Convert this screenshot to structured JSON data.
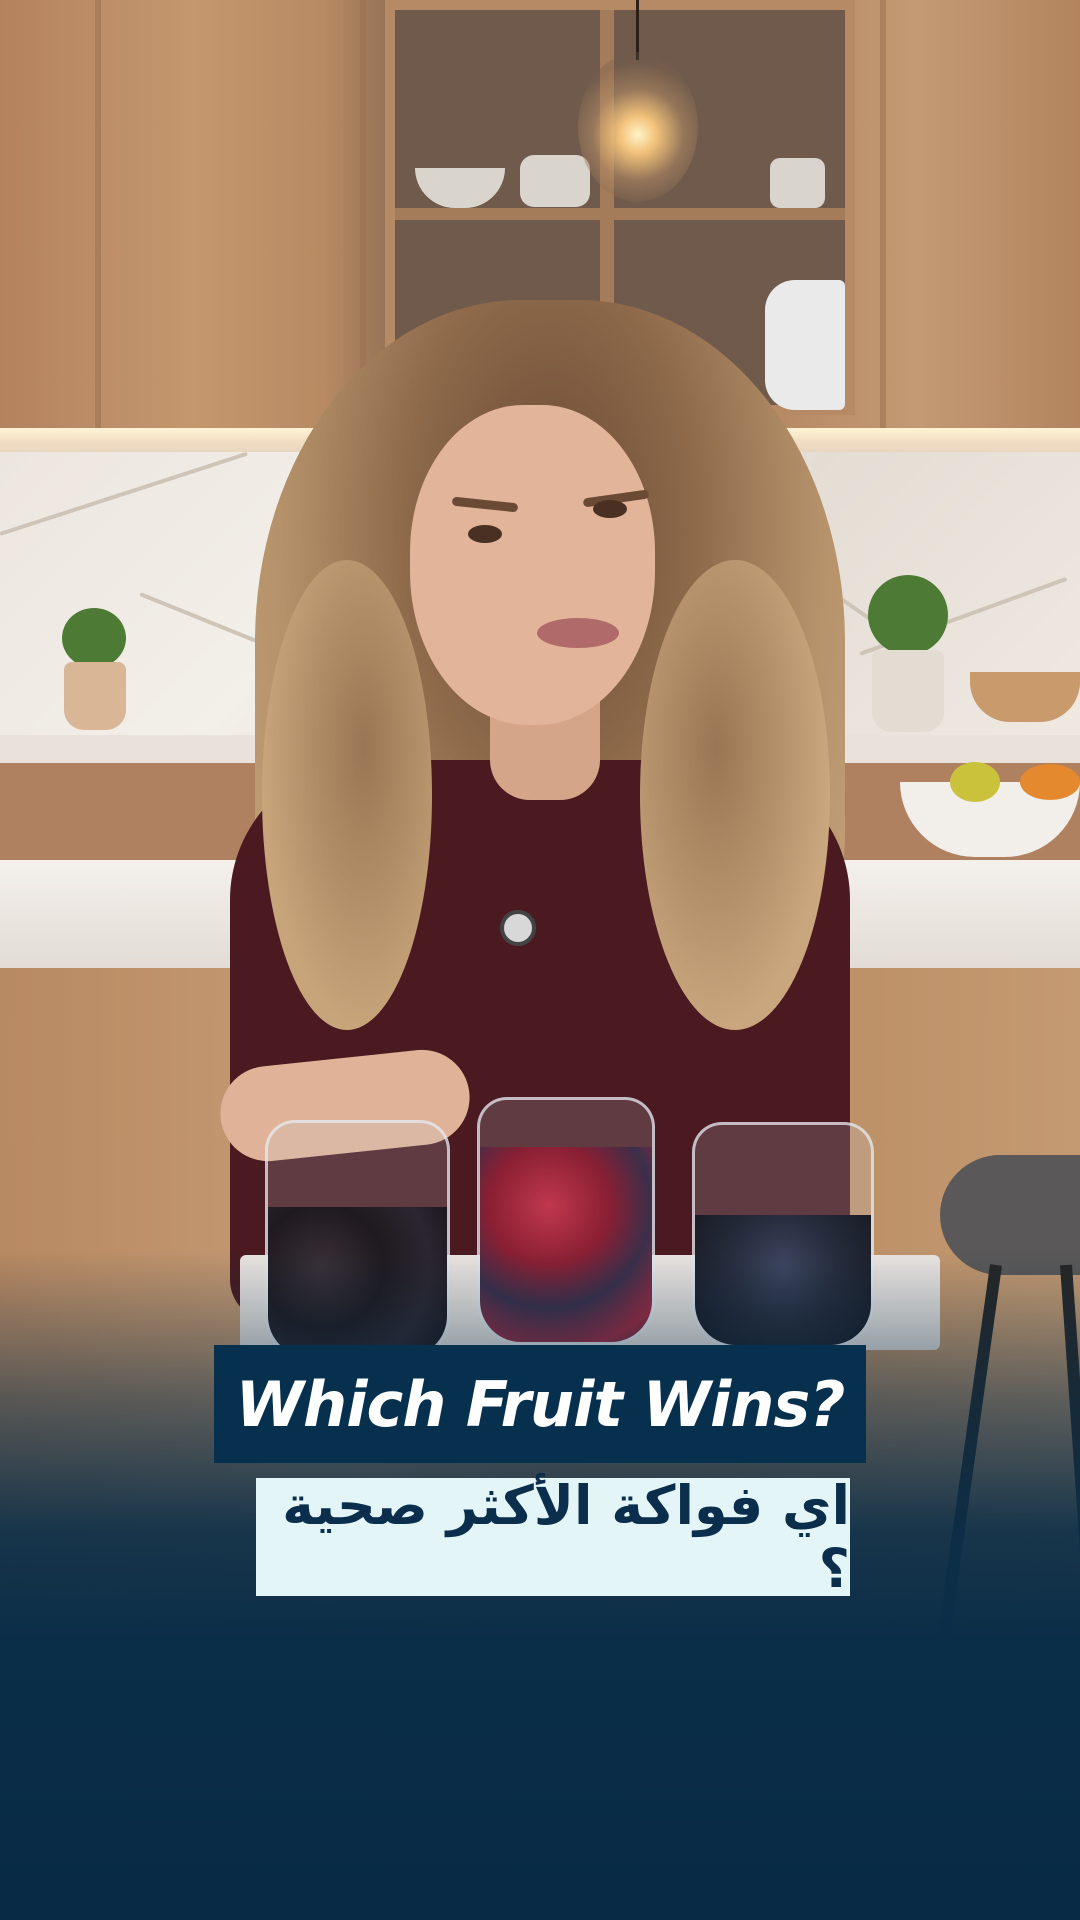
{
  "overlay": {
    "title_en": "Which Fruit Wins?",
    "title_ar": "اي فواكة الأكثر صحية ؟"
  },
  "colors": {
    "title_en_background": "#07304f",
    "title_en_text": "#ffffff",
    "title_ar_background": "#e4f5f8",
    "title_ar_text": "#0a2e4c",
    "bottom_gradient": "#0b2e48",
    "sweater": "#4a1a20"
  },
  "scene": {
    "setting": "kitchen",
    "glasses": [
      "dark-purple-fruit",
      "red-berries",
      "dark-blue-berries"
    ]
  }
}
